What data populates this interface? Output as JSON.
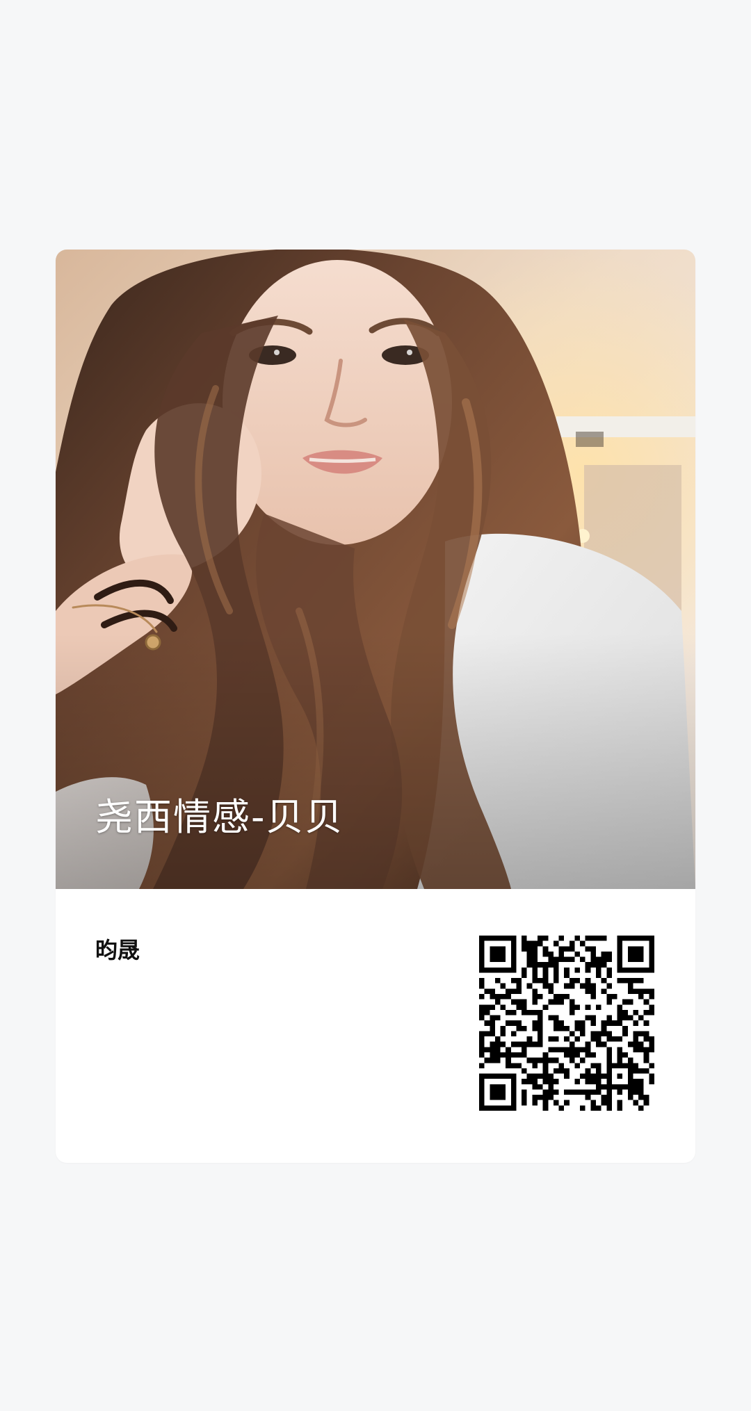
{
  "card": {
    "title": "尧西情感-贝贝",
    "owner_name": "昀晟"
  },
  "colors": {
    "page_background": "#f6f7f8",
    "card_background": "#ffffff",
    "title_text": "#ffffff",
    "owner_text": "#111111",
    "qr_dark": "#000000"
  },
  "icons": {
    "qr_code": "qr-code-icon",
    "photo": "profile-photo"
  }
}
